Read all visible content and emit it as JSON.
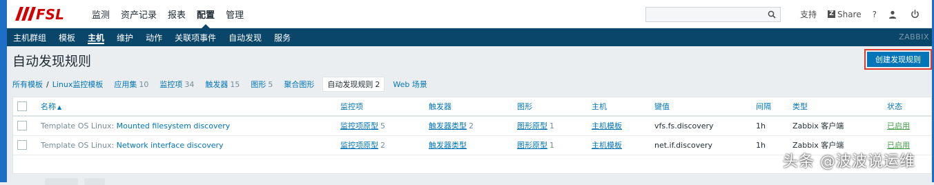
{
  "top_nav": {
    "logo_text": "ZABBIX",
    "items": [
      "监测",
      "资产记录",
      "报表",
      "配置",
      "管理"
    ],
    "active_index": 3,
    "search": {
      "value": "",
      "placeholder": ""
    },
    "support_label": "支持",
    "share_badge": "Z",
    "share_label": "Share",
    "help_label": "?"
  },
  "sub_nav": {
    "items": [
      "主机群组",
      "模板",
      "主机",
      "维护",
      "动作",
      "关联项事件",
      "自动发现",
      "服务"
    ],
    "active_index": 2,
    "brand": "ZABBIX"
  },
  "page": {
    "title": "自动发现规则",
    "create_button": "创建发现规则"
  },
  "breadcrumb": {
    "all_templates": "所有模板",
    "separator": "/",
    "template": "Linux监控模板",
    "tabs": [
      {
        "label": "应用集",
        "count": "10"
      },
      {
        "label": "监控项",
        "count": "34"
      },
      {
        "label": "触发器",
        "count": "15"
      },
      {
        "label": "图形",
        "count": "5"
      },
      {
        "label": "聚合图形",
        "count": ""
      },
      {
        "label": "自动发现规则",
        "count": "2"
      },
      {
        "label": "Web 场景",
        "count": ""
      }
    ],
    "active_tab_index": 5
  },
  "table": {
    "columns": [
      "名称",
      "监控项",
      "触发器",
      "图形",
      "主机",
      "键值",
      "间隔",
      "类型",
      "状态"
    ],
    "sort_indicator": "▲",
    "rows": [
      {
        "template_prefix": "Template OS Linux:",
        "name": "Mounted filesystem discovery",
        "items_label": "监控项原型",
        "items_count": "5",
        "triggers_label": "触发器类型",
        "triggers_count": "2",
        "graphs_label": "图形原型",
        "graphs_count": "1",
        "hosts_label": "主机模板",
        "key": "vfs.fs.discovery",
        "interval": "1h",
        "type": "Zabbix 客户端",
        "status": "已启用"
      },
      {
        "template_prefix": "Template OS Linux:",
        "name": "Network interface discovery",
        "items_label": "监控项原型",
        "items_count": "2",
        "triggers_label": "触发器类型",
        "triggers_count": "",
        "graphs_label": "图形原型",
        "graphs_count": "1",
        "hosts_label": "主机模板",
        "key": "net.if.discovery",
        "interval": "1h",
        "type": "Zabbix 客户端",
        "status": "已启用"
      }
    ]
  },
  "watermark": "头条 @波波说运维",
  "colors": {
    "primary": "#0275b8",
    "subnav_bg": "#0a466a",
    "logo_red": "#d40000",
    "status_enabled": "#429e47",
    "highlight_box": "#e23a2f",
    "frame": "#1f6ec5"
  }
}
